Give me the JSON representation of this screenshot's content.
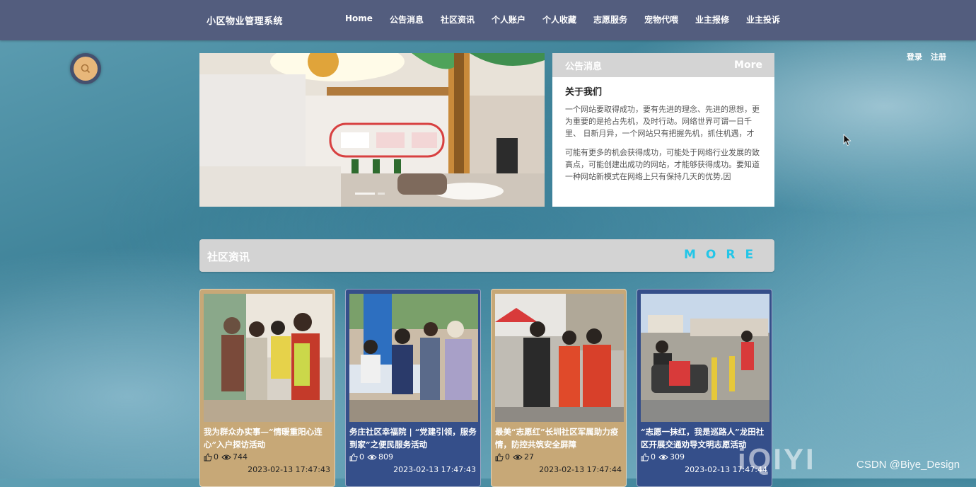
{
  "header": {
    "brand": "小区物业管理系统",
    "nav": [
      "Home",
      "公告消息",
      "社区资讯",
      "个人账户",
      "个人收藏",
      "志愿服务",
      "宠物代喂",
      "业主报修",
      "业主投诉"
    ]
  },
  "auth": {
    "login": "登录",
    "register": "注册"
  },
  "notice": {
    "header": "公告消息",
    "more": "More",
    "title": "关于我们",
    "para1": "一个网站要取得成功，要有先进的理念、先进的思想，更为重要的是抢占先机，及时行动。网络世界可谓一日千里、 日新月异，一个网站只有把握先机，抓住机遇，才",
    "para2": "可能有更多的机会获得成功，可能处于网络行业发展的致高点，可能创建出成功的网站，才能够获得成功。要知道一种网站新模式在网络上只有保持几天的优势,因"
  },
  "section": {
    "title": "社区资讯",
    "more": "MORE"
  },
  "cards": [
    {
      "title": "我为群众办实事—“情暖重阳心连心”入户探访活动",
      "likes": "0",
      "views": "744",
      "date": "2023-02-13 17:47:43"
    },
    {
      "title": "务庄社区幸福院 | “党建引领，服务到家”之便民服务活动",
      "likes": "0",
      "views": "809",
      "date": "2023-02-13 17:47:43"
    },
    {
      "title": "最美“志愿红”长圳社区军属助力疫情，防控共筑安全屏障",
      "likes": "0",
      "views": "27",
      "date": "2023-02-13 17:47:44"
    },
    {
      "title": "“志愿一抹红，我是巡路人”龙田社区开展交通劝导文明志愿活动",
      "likes": "0",
      "views": "309",
      "date": "2023-02-13 17:47:44"
    }
  ],
  "overlay": {
    "watermark": "CSDN @Biye_Design",
    "logo": "iQIYI"
  },
  "colors": {
    "topbar": "#535d7e",
    "accent_more": "#22c6e8",
    "card_tan": "#c7a877",
    "card_blue": "#354f8a"
  }
}
